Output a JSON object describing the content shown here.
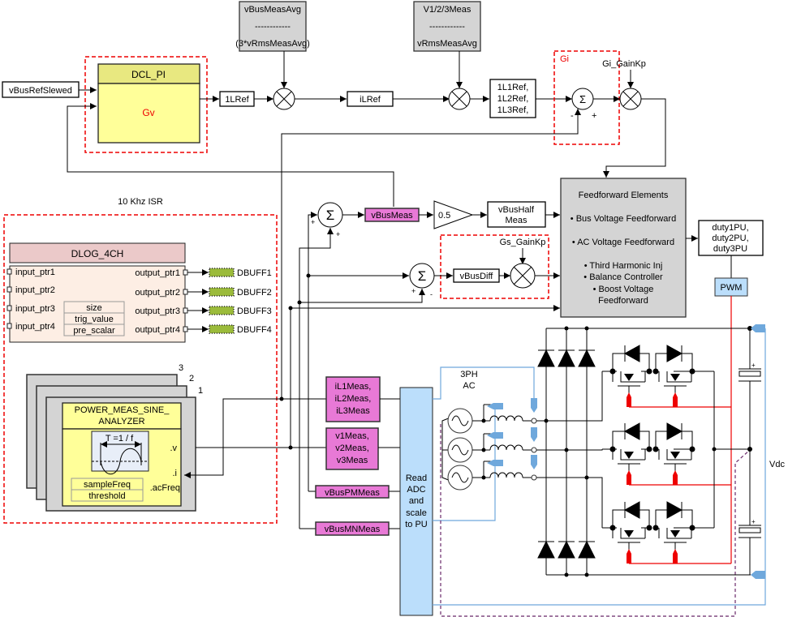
{
  "voltage_loop": {
    "input_label": "vBusRefSlewed",
    "controller_title": "DCL_PI",
    "controller_gain": "Gv",
    "output_label": "1LRef",
    "divider_top": "vBusMeasAvg",
    "divider_line": "------------",
    "divider_bottom": "(3*vRmsMeasAvg)"
  },
  "current_ref": {
    "label": "iLRef",
    "divider_top": "V1/2/3Meas",
    "divider_line": "------------",
    "divider_bottom": "vRmsMeasAvg",
    "refs": [
      "1L1Ref,",
      "1L2Ref,",
      "1L3Ref,"
    ]
  },
  "current_loop": {
    "title": "Gi",
    "gain_label": "Gi_GainKp",
    "sum_symbol": "Σ",
    "minus": "-",
    "plus": "+"
  },
  "isr_label": "10 Khz ISR",
  "dlog": {
    "title": "DLOG_4CH",
    "inputs": [
      "input_ptr1",
      "input_ptr2",
      "input_ptr3",
      "input_ptr4"
    ],
    "outputs": [
      "output_ptr1",
      "output_ptr2",
      "output_ptr3",
      "output_ptr4"
    ],
    "params": [
      "size",
      "trig_value",
      "pre_scalar"
    ],
    "buffers": [
      "DBUFF1",
      "DBUFF2",
      "DBUFF3",
      "DBUFF4"
    ]
  },
  "power_meas": {
    "stack_numbers": [
      "3",
      "2",
      "1"
    ],
    "title_line1": "POWER_MEAS_SINE_",
    "title_line2": "ANALYZER",
    "period_label": "T =1 / f",
    "params": [
      "sampleFreq",
      "threshold"
    ],
    "ports": [
      ".v",
      ".i",
      ".acFreq"
    ]
  },
  "bus": {
    "sum_symbol": "Σ",
    "plus": "+",
    "minus": "-",
    "vbus_meas": "vBusMeas",
    "gain": "0.5",
    "vbus_half": [
      "vBusHalf",
      "Meas"
    ],
    "balance_gain_label": "Gs_GainKp",
    "vbus_diff": "vBusDiff"
  },
  "feedforward": {
    "title": "Feedforward Elements",
    "items": [
      "• Bus Voltage Feedforward",
      "• AC Voltage Feedforward",
      "• Third Harmonic Inj",
      "• Balance Controller",
      "• Boost Voltage",
      "Feedforward"
    ]
  },
  "duty": [
    "duty1PU,",
    "duty2PU,",
    "duty3PU"
  ],
  "pwm_label": "PWM",
  "measurements": {
    "il": [
      "iL1Meas,",
      "iL2Meas,",
      "iL3Meas"
    ],
    "v": [
      "v1Meas,",
      "v2Meas,",
      "v3Meas"
    ],
    "vbus_pm": "vBusPMMeas",
    "vbus_mn": "vBusMNMeas"
  },
  "adc": [
    "Read",
    "ADC",
    "and",
    "scale",
    "to PU"
  ],
  "power_stage": {
    "ac_label": [
      "3PH",
      "AC"
    ],
    "vdc_label": "Vdc",
    "cap_plus": "+"
  },
  "colors": {
    "pink": "#e879d6",
    "gray": "#d4d4d4",
    "pi_header": "#e8e880",
    "pi_body": "#ffff99",
    "dlog_header": "#ebc9c9",
    "dlog_body": "#fdeee4",
    "adc_blue": "#bbdefb",
    "sense_blue": "#6fa8dc",
    "pwm_red": "#e00000",
    "buffer_green": "#9bbb3b"
  }
}
